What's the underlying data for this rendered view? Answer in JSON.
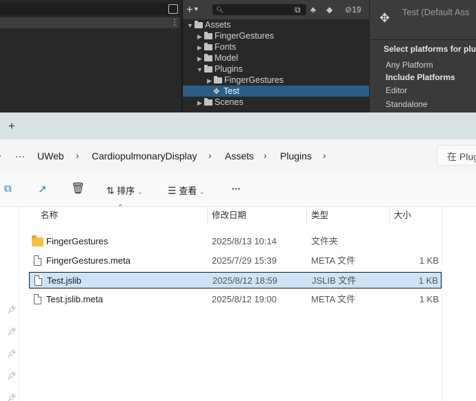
{
  "unity": {
    "project_search_placeholder": "",
    "hidden_count": "19",
    "tree": [
      {
        "label": "Assets",
        "depth": 0,
        "expanded": true,
        "icon": "folder"
      },
      {
        "label": "FingerGestures",
        "depth": 1,
        "expanded": false,
        "icon": "folder"
      },
      {
        "label": "Fonts",
        "depth": 1,
        "expanded": false,
        "icon": "folder"
      },
      {
        "label": "Model",
        "depth": 1,
        "expanded": false,
        "icon": "folder"
      },
      {
        "label": "Plugins",
        "depth": 1,
        "expanded": true,
        "icon": "folder"
      },
      {
        "label": "FingerGestures",
        "depth": 2,
        "expanded": false,
        "icon": "folder"
      },
      {
        "label": "Test",
        "depth": 2,
        "selected": true,
        "icon": "file"
      },
      {
        "label": "Scenes",
        "depth": 1,
        "expanded": false,
        "icon": "folder"
      }
    ],
    "inspector": {
      "title": "Test (Default Ass",
      "section_label": "Select platforms for plu",
      "any_platform": "Any Platform",
      "include_platforms": "Include Platforms",
      "editor": "Editor",
      "standalone": "Standalone"
    },
    "colors": {
      "selection": "#2c5d87",
      "panel": "#282828"
    }
  },
  "explorer": {
    "new_tab": "+",
    "breadcrumb": {
      "more": "···",
      "items": [
        "UWeb",
        "CardiopulmonaryDisplay",
        "Assets",
        "Plugins"
      ]
    },
    "search_placeholder": "在 Plug",
    "command_bar": {
      "sort_label": "排序",
      "view_label": "查看",
      "more_label": "···"
    },
    "columns": {
      "name": "名称",
      "date": "修改日期",
      "type": "类型",
      "size": "大小"
    },
    "files": [
      {
        "name": "FingerGestures",
        "date": "2025/8/13 10:14",
        "type": "文件夹",
        "size": "",
        "icon": "folder"
      },
      {
        "name": "FingerGestures.meta",
        "date": "2025/7/29 15:39",
        "type": "META 文件",
        "size": "1 KB",
        "icon": "file"
      },
      {
        "name": "Test.jslib",
        "date": "2025/8/12 18:59",
        "type": "JSLIB 文件",
        "size": "1 KB",
        "icon": "file",
        "selected": true
      },
      {
        "name": "Test.jslib.meta",
        "date": "2025/8/12 19:00",
        "type": "META 文件",
        "size": "1 KB",
        "icon": "file"
      }
    ],
    "colors": {
      "selection": "#cce4f7",
      "folder": "#f6c143",
      "accent": "#2a6fb8"
    }
  }
}
